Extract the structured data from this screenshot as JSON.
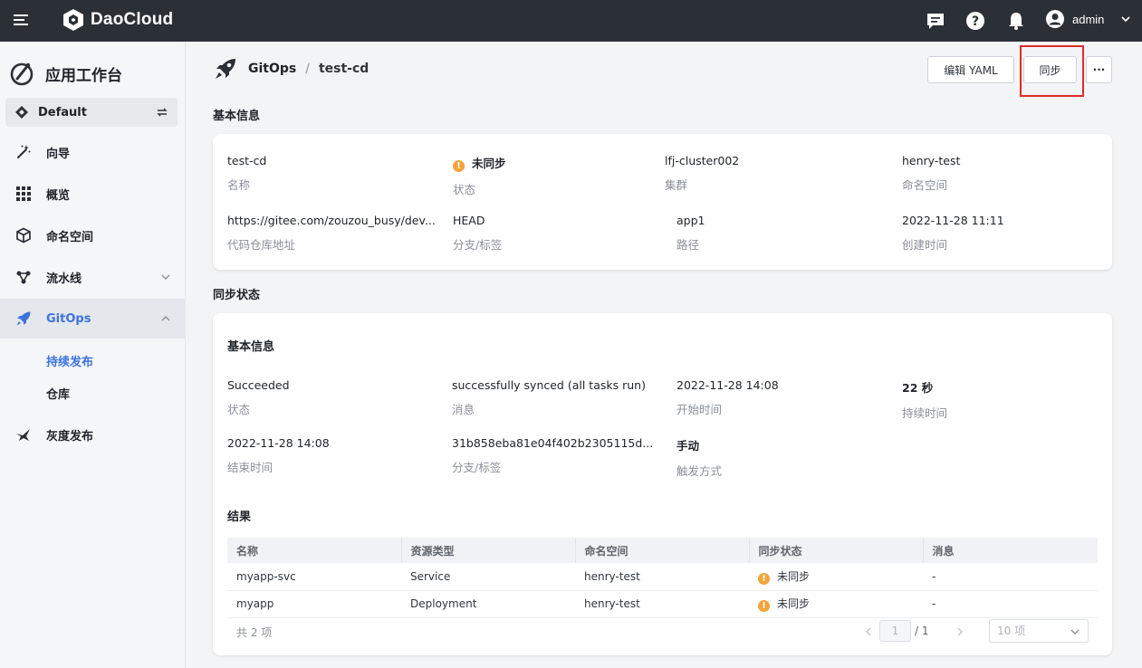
{
  "app": {
    "brand": "DaoCloud",
    "user": "admin"
  },
  "sidebar": {
    "title": "应用工作台",
    "workspace": "Default",
    "items": [
      {
        "label": "向导",
        "icon": "wand-icon"
      },
      {
        "label": "概览",
        "icon": "grid-icon"
      },
      {
        "label": "命名空间",
        "icon": "cube-icon"
      },
      {
        "label": "流水线",
        "icon": "pipeline-icon"
      },
      {
        "label": "GitOps",
        "icon": "rocket-icon"
      },
      {
        "label": "灰度发布",
        "icon": "bird-icon"
      }
    ],
    "subitems": [
      {
        "label": "持续发布"
      },
      {
        "label": "仓库"
      }
    ]
  },
  "breadcrumb": {
    "section": "GitOps",
    "current": "test-cd"
  },
  "actions": {
    "edit_yaml": "编辑 YAML",
    "sync": "同步",
    "more": "···"
  },
  "basic": {
    "title": "基本信息",
    "fields": [
      {
        "value": "test-cd",
        "label": "名称"
      },
      {
        "value": "未同步",
        "label": "状态"
      },
      {
        "value": "lfj-cluster002",
        "label": "集群"
      },
      {
        "value": "henry-test",
        "label": "命名空间"
      },
      {
        "value": "https://gitee.com/zouzou_busy/dev...",
        "label": "代码仓库地址"
      },
      {
        "value": "HEAD",
        "label": "分支/标签"
      },
      {
        "value": "app1",
        "label": "路径"
      },
      {
        "value": "2022-11-28 11:11",
        "label": "创建时间"
      }
    ]
  },
  "sync": {
    "title": "同步状态",
    "sub_title": "基本信息",
    "fields": [
      {
        "value": "Succeeded",
        "label": "状态"
      },
      {
        "value": "successfully synced (all tasks run)",
        "label": "消息"
      },
      {
        "value": "2022-11-28 14:08",
        "label": "开始时间"
      },
      {
        "value": "22 秒",
        "label": "持续时间"
      },
      {
        "value": "2022-11-28 14:08",
        "label": "结束时间"
      },
      {
        "value": "31b858eba81e04f402b2305115d...",
        "label": "分支/标签"
      },
      {
        "value": "手动",
        "label": "触发方式"
      }
    ],
    "result_title": "结果",
    "table": {
      "headers": [
        "名称",
        "资源类型",
        "命名空间",
        "同步状态",
        "消息"
      ],
      "rows": [
        [
          "myapp-svc",
          "Service",
          "henry-test",
          "未同步",
          "-"
        ],
        [
          "myapp",
          "Deployment",
          "henry-test",
          "未同步",
          "-"
        ]
      ]
    },
    "pager": {
      "total": "共 2 项",
      "page": "1",
      "pages": "/ 1",
      "size": "10 项"
    }
  },
  "colors": {
    "accent": "#3d73de",
    "warning": "#f3a33a",
    "highlight": "#e02b2b",
    "topbar": "#2b2f36"
  }
}
